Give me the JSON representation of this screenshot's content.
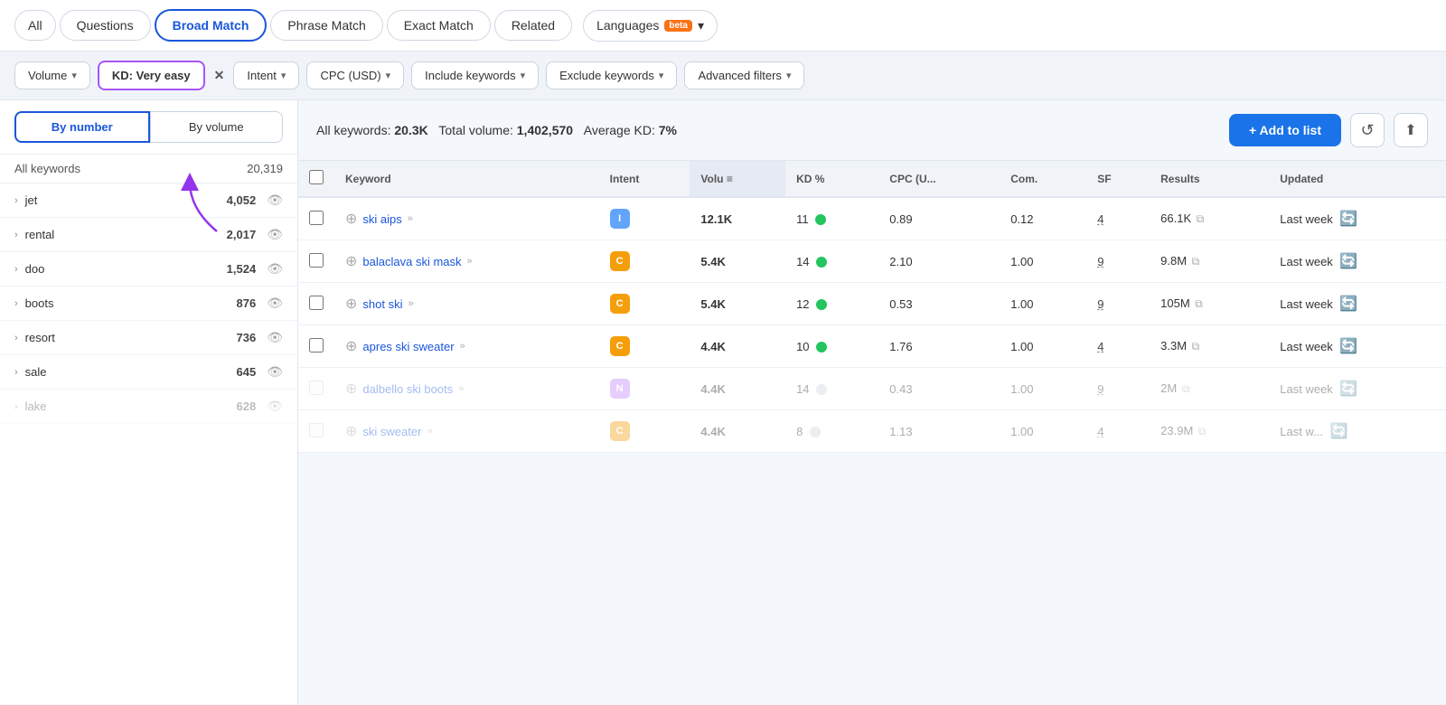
{
  "tabs": {
    "items": [
      {
        "id": "all",
        "label": "All",
        "active": false
      },
      {
        "id": "questions",
        "label": "Questions",
        "active": false
      },
      {
        "id": "broad-match",
        "label": "Broad Match",
        "active": true
      },
      {
        "id": "phrase-match",
        "label": "Phrase Match",
        "active": false
      },
      {
        "id": "exact-match",
        "label": "Exact Match",
        "active": false
      },
      {
        "id": "related",
        "label": "Related",
        "active": false
      },
      {
        "id": "languages",
        "label": "Languages",
        "active": false,
        "badge": "beta"
      }
    ]
  },
  "filters": {
    "volume": {
      "label": "Volume",
      "chevron": "▾"
    },
    "kd": {
      "label": "KD: Very easy",
      "active": true,
      "closeBtn": "✕"
    },
    "intent": {
      "label": "Intent",
      "chevron": "▾"
    },
    "cpc": {
      "label": "CPC (USD)",
      "chevron": "▾"
    },
    "include": {
      "label": "Include keywords",
      "chevron": "▾"
    },
    "exclude": {
      "label": "Exclude keywords",
      "chevron": "▾"
    },
    "advanced": {
      "label": "Advanced filters",
      "chevron": "▾"
    }
  },
  "sidebar": {
    "toggle": {
      "byNumber": "By number",
      "byVolume": "By volume",
      "activeTab": "byNumber"
    },
    "header": {
      "left": "All keywords",
      "right": "20,319"
    },
    "items": [
      {
        "keyword": "jet",
        "count": "4,052",
        "visible": true,
        "dimmed": false
      },
      {
        "keyword": "rental",
        "count": "2,017",
        "visible": true,
        "dimmed": false
      },
      {
        "keyword": "doo",
        "count": "1,524",
        "visible": true,
        "dimmed": false
      },
      {
        "keyword": "boots",
        "count": "876",
        "visible": true,
        "dimmed": false
      },
      {
        "keyword": "resort",
        "count": "736",
        "visible": true,
        "dimmed": false
      },
      {
        "keyword": "sale",
        "count": "645",
        "visible": true,
        "dimmed": false
      },
      {
        "keyword": "lake",
        "count": "628",
        "visible": true,
        "dimmed": true
      }
    ]
  },
  "summary": {
    "allKeywords": "20.3K",
    "totalVolume": "1,402,570",
    "avgKD": "7%",
    "addToListLabel": "+ Add to list"
  },
  "table": {
    "columns": [
      {
        "id": "check",
        "label": ""
      },
      {
        "id": "keyword",
        "label": "Keyword"
      },
      {
        "id": "intent",
        "label": "Intent"
      },
      {
        "id": "volume",
        "label": "Volu",
        "sorted": true
      },
      {
        "id": "kd",
        "label": "KD %"
      },
      {
        "id": "cpc",
        "label": "CPC (U..."
      },
      {
        "id": "com",
        "label": "Com."
      },
      {
        "id": "sf",
        "label": "SF"
      },
      {
        "id": "results",
        "label": "Results"
      },
      {
        "id": "updated",
        "label": "Updated"
      }
    ],
    "rows": [
      {
        "keyword": "ski aips",
        "arrows": "»",
        "intent": "I",
        "intentClass": "intent-i",
        "volume": "12.1K",
        "kd": "11",
        "kdDotClass": "dot-green",
        "cpc": "0.89",
        "com": "0.12",
        "sf": "4",
        "results": "66.1K",
        "updated": "Last week",
        "dimmed": false
      },
      {
        "keyword": "balaclava ski mask",
        "arrows": "»",
        "intent": "C",
        "intentClass": "intent-c",
        "volume": "5.4K",
        "kd": "14",
        "kdDotClass": "dot-green",
        "cpc": "2.10",
        "com": "1.00",
        "sf": "9",
        "results": "9.8M",
        "updated": "Last week",
        "dimmed": false
      },
      {
        "keyword": "shot ski",
        "arrows": "»",
        "intent": "C",
        "intentClass": "intent-c",
        "volume": "5.4K",
        "kd": "12",
        "kdDotClass": "dot-green",
        "cpc": "0.53",
        "com": "1.00",
        "sf": "9",
        "results": "105M",
        "updated": "Last week",
        "dimmed": false
      },
      {
        "keyword": "apres ski sweater",
        "arrows": "»",
        "intent": "C",
        "intentClass": "intent-c",
        "volume": "4.4K",
        "kd": "10",
        "kdDotClass": "dot-green",
        "cpc": "1.76",
        "com": "1.00",
        "sf": "4",
        "results": "3.3M",
        "updated": "Last week",
        "dimmed": false
      },
      {
        "keyword": "dalbello ski boots",
        "arrows": "»",
        "intent": "N",
        "intentClass": "intent-n",
        "volume": "4.4K",
        "kd": "14",
        "kdDotClass": "dot-gray",
        "cpc": "0.43",
        "com": "1.00",
        "sf": "9",
        "results": "2M",
        "updated": "Last week",
        "dimmed": true
      },
      {
        "keyword": "ski sweater",
        "arrows": "»",
        "intent": "C",
        "intentClass": "intent-c",
        "volume": "4.4K",
        "kd": "8",
        "kdDotClass": "dot-gray",
        "cpc": "1.13",
        "com": "1.00",
        "sf": "4",
        "results": "23.9M",
        "updated": "Last w...",
        "dimmed": true
      }
    ]
  }
}
